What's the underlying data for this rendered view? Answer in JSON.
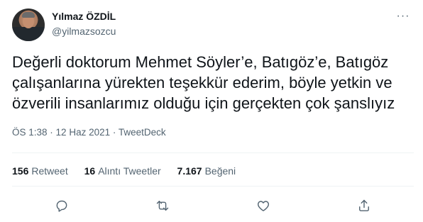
{
  "author": {
    "name": "Yılmaz ÖZDİL",
    "handle": "@yilmazsozcu"
  },
  "tweet": {
    "text": "Değerli doktorum Mehmet Söyler’e, Batıgöz’e, Batıgöz\nçalışanlarına yürekten teşekkür ederim, böyle yetkin ve\nözverili insanlarımız olduğu için gerçekten çok şanslıyız",
    "time": "ÖS 1:38",
    "separator": "·",
    "date": "12 Haz 2021",
    "source": "TweetDeck"
  },
  "stats": {
    "retweets": {
      "count": "156",
      "label": "Retweet"
    },
    "quotes": {
      "count": "16",
      "label": "Alıntı Tweetler"
    },
    "likes": {
      "count": "7.167",
      "label": "Beğeni"
    }
  },
  "more_menu_glyph": "···",
  "icons": [
    "reply-icon",
    "retweet-icon",
    "like-icon",
    "share-icon"
  ],
  "colors": {
    "text": "#0f1419",
    "secondary": "#536471",
    "divider": "#eff3f4"
  }
}
